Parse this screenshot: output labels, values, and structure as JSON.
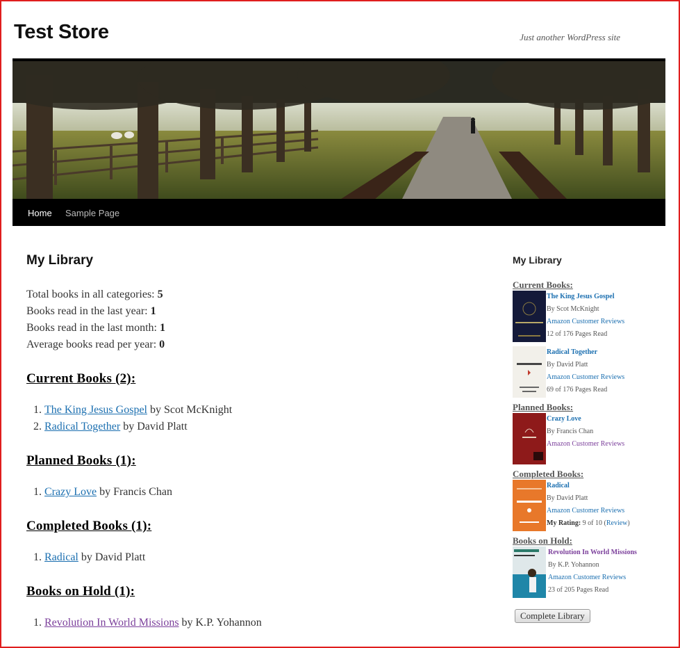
{
  "site": {
    "title": "Test Store",
    "tagline": "Just another WordPress site"
  },
  "nav": {
    "home": "Home",
    "sample": "Sample Page"
  },
  "main": {
    "title": "My Library",
    "stats": [
      {
        "label": "Total books in all categories: ",
        "value": "5"
      },
      {
        "label": "Books read in the last year: ",
        "value": "1"
      },
      {
        "label": "Books read in the last month: ",
        "value": "1"
      },
      {
        "label": "Average books read per year: ",
        "value": "0"
      }
    ],
    "sections": [
      {
        "title": "Current Books (2):",
        "books": [
          {
            "title": "The King Jesus Gospel",
            "author": " by Scot McKnight"
          },
          {
            "title": "Radical Together",
            "author": " by David Platt"
          }
        ]
      },
      {
        "title": "Planned Books (1):",
        "books": [
          {
            "title": "Crazy Love",
            "author": " by Francis Chan"
          }
        ]
      },
      {
        "title": "Completed Books (1):",
        "books": [
          {
            "title": "Radical",
            "author": " by David Platt"
          }
        ]
      },
      {
        "title": "Books on Hold (1):",
        "books": [
          {
            "title": "Revolution In World Missions",
            "author": " by K.P. Yohannon"
          }
        ]
      }
    ]
  },
  "sidebar": {
    "title": "My Library",
    "current_heading": "Current Books:",
    "planned_heading": "Planned Books:",
    "completed_heading": "Completed Books:",
    "hold_heading": "Books on Hold:",
    "books": [
      {
        "title": "The King Jesus Gospel",
        "author": "By Scot McKnight",
        "reviews": "Amazon Customer Reviews",
        "progress": "12 of 176 Pages Read",
        "cover_text": "KING JESUS GOSPEL"
      },
      {
        "title": "Radical Together",
        "author": "By David Platt",
        "reviews": "Amazon Customer Reviews",
        "progress": "69 of 176 Pages Read",
        "cover_text": "RADICAL"
      },
      {
        "title": "Crazy Love",
        "author": "By Francis Chan",
        "reviews": "Amazon Customer Reviews",
        "cover_text": "Crazy Love"
      },
      {
        "title": "Radical",
        "author": "By David Platt",
        "reviews": "Amazon Customer Reviews",
        "rating_label": "My Rating:",
        "rating_value": " 9 of 10 (",
        "rating_link": "Review",
        "rating_close": ")",
        "cover_text": "RADICAL"
      },
      {
        "title": "Revolution In World Missions",
        "author": "By K.P. Yohannon",
        "reviews": "Amazon Customer Reviews",
        "progress": "23 of 205 Pages Read",
        "cover_text": "Revolution"
      }
    ],
    "button": "Complete Library"
  },
  "colors": {
    "link": "#1b6fb0",
    "visited": "#7b3f9b",
    "nav_bg": "#000000",
    "border": "#e01e1e"
  }
}
